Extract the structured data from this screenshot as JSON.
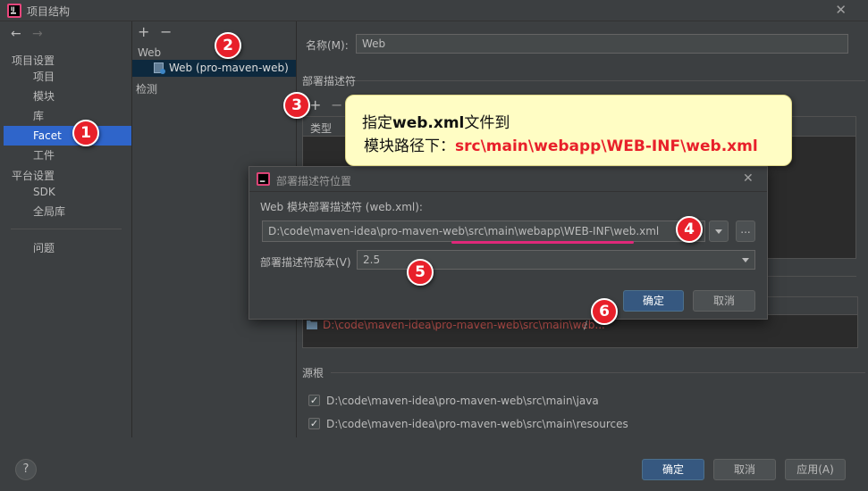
{
  "window": {
    "title": "项目结构",
    "close_icon": "close-icon"
  },
  "sidebar": {
    "back_icon": "←",
    "forward_icon": "→",
    "section_project": "项目设置",
    "items_project": [
      "项目",
      "模块",
      "库",
      "Facet",
      "工件"
    ],
    "section_platform": "平台设置",
    "items_platform": [
      "SDK",
      "全局库"
    ],
    "problems": "问题",
    "selected": "Facet"
  },
  "middle": {
    "add": "+",
    "remove": "−",
    "group_web": "Web",
    "tree_item": "Web (pro-maven-web)",
    "group_detect": "检测"
  },
  "right": {
    "name_label": "名称(M):",
    "name_value": "Web",
    "deploy_section": "部署描述符",
    "deploy_add": "+",
    "deploy_remove": "−",
    "type_header": "类型",
    "web_resource_path": "D:\\code\\maven-idea\\pro-maven-web\\src\\main\\web...",
    "web_resource_rel": "/",
    "source_section": "源根",
    "source_roots": [
      "D:\\code\\maven-idea\\pro-maven-web\\src\\main\\java",
      "D:\\code\\maven-idea\\pro-maven-web\\src\\main\\resources"
    ]
  },
  "callout": {
    "line1_prefix": "指定",
    "line1_bold": "web.xml",
    "line1_suffix": "文件到",
    "line2_prefix": "模块路径下：",
    "line2_path": "src\\main\\webapp\\WEB-INF\\web.xml"
  },
  "dialog": {
    "title": "部署描述符位置",
    "path_label": "Web 模块部署描述符 (web.xml):",
    "path_value": "D:\\code\\maven-idea\\pro-maven-web\\src\\main\\webapp\\WEB-INF\\web.xml",
    "browse": "...",
    "version_label": "部署描述符版本(V)",
    "version_value": "2.5",
    "ok": "确定",
    "cancel": "取消"
  },
  "bottom": {
    "help": "?",
    "ok": "确定",
    "cancel": "取消",
    "apply": "应用(A)"
  },
  "badges": [
    "1",
    "2",
    "3",
    "4",
    "5",
    "6"
  ],
  "colors": {
    "accent_selection": "#2f65ca",
    "badge": "#e8202a",
    "callout_bg": "#fffdc4",
    "error_path": "#c75450"
  }
}
